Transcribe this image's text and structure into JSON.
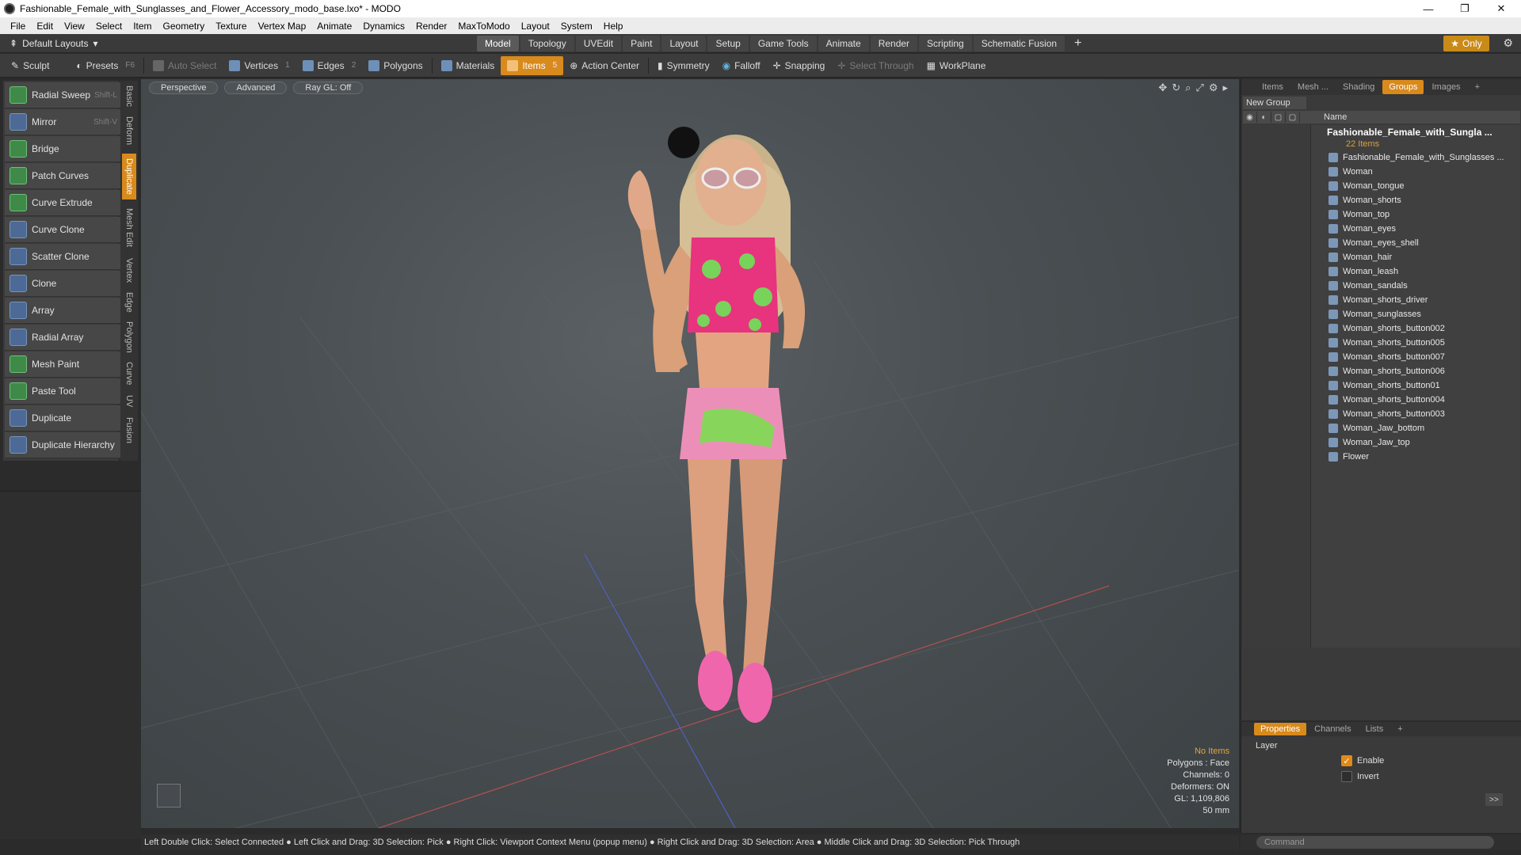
{
  "window": {
    "title": "Fashionable_Female_with_Sunglasses_and_Flower_Accessory_modo_base.lxo* - MODO",
    "controls": {
      "minimize": "—",
      "maximize": "❐",
      "close": "✕"
    }
  },
  "menu": [
    "File",
    "Edit",
    "View",
    "Select",
    "Item",
    "Geometry",
    "Texture",
    "Vertex Map",
    "Animate",
    "Dynamics",
    "Render",
    "MaxToModo",
    "Layout",
    "System",
    "Help"
  ],
  "layouts": {
    "preset": "Default Layouts",
    "tabs": [
      "Model",
      "Topology",
      "UVEdit",
      "Paint",
      "Layout",
      "Setup",
      "Game Tools",
      "Animate",
      "Render",
      "Scripting",
      "Schematic Fusion"
    ],
    "active_tab": "Model",
    "add": "+",
    "only": "Only"
  },
  "toolbar": {
    "sculpt": "Sculpt",
    "presets": "Presets",
    "presets_key": "F6",
    "auto_select": "Auto Select",
    "vertices": "Vertices",
    "vertices_count": "1",
    "edges": "Edges",
    "edges_count": "2",
    "polygons": "Polygons",
    "materials": "Materials",
    "items": "Items",
    "items_count": "5",
    "action_center": "Action Center",
    "symmetry": "Symmetry",
    "falloff": "Falloff",
    "snapping": "Snapping",
    "select_through": "Select Through",
    "workplane": "WorkPlane"
  },
  "tools": [
    {
      "label": "Radial Sweep",
      "shortcut": "Shift-L"
    },
    {
      "label": "Mirror",
      "shortcut": "Shift-V"
    },
    {
      "label": "Bridge",
      "shortcut": ""
    },
    {
      "label": "Patch Curves",
      "shortcut": ""
    },
    {
      "label": "Curve Extrude",
      "shortcut": ""
    },
    {
      "label": "Curve Clone",
      "shortcut": ""
    },
    {
      "label": "Scatter Clone",
      "shortcut": ""
    },
    {
      "label": "Clone",
      "shortcut": ""
    },
    {
      "label": "Array",
      "shortcut": ""
    },
    {
      "label": "Radial Array",
      "shortcut": ""
    },
    {
      "label": "Mesh Paint",
      "shortcut": ""
    },
    {
      "label": "Paste Tool",
      "shortcut": ""
    },
    {
      "label": "Duplicate",
      "shortcut": ""
    },
    {
      "label": "Duplicate Hierarchy",
      "shortcut": ""
    }
  ],
  "side_tabs": [
    "Basic",
    "Deform",
    "Duplicate",
    "Mesh Edit",
    "Vertex",
    "Edge",
    "Polygon",
    "Curve",
    "UV",
    "Fusion"
  ],
  "active_side_tab": "Duplicate",
  "viewport": {
    "view": "Perspective",
    "shading": "Advanced",
    "raygl": "Ray GL: Off",
    "info": {
      "selection": "No Items",
      "polygons": "Polygons : Face",
      "channels": "Channels: 0",
      "deformers": "Deformers: ON",
      "gl": "GL: 1,109,806",
      "focal": "50 mm"
    }
  },
  "status_bar": "Left Double Click: Select Connected ● Left Click and Drag: 3D Selection: Pick ● Right Click: Viewport Context Menu (popup menu) ● Right Click and Drag: 3D Selection: Area ● Middle Click and Drag: 3D Selection: Pick Through",
  "right_panel": {
    "tabs": [
      "Items",
      "Mesh ...",
      "Shading",
      "Groups",
      "Images",
      "+"
    ],
    "active_tab": "Groups",
    "new_group": "New Group",
    "column_name": "Name",
    "group_name": "Fashionable_Female_with_Sungla ...",
    "group_count": "22 Items",
    "items": [
      "Fashionable_Female_with_Sunglasses ...",
      "Woman",
      "Woman_tongue",
      "Woman_shorts",
      "Woman_top",
      "Woman_eyes",
      "Woman_eyes_shell",
      "Woman_hair",
      "Woman_leash",
      "Woman_sandals",
      "Woman_shorts_driver",
      "Woman_sunglasses",
      "Woman_shorts_button002",
      "Woman_shorts_button005",
      "Woman_shorts_button007",
      "Woman_shorts_button006",
      "Woman_shorts_button01",
      "Woman_shorts_button004",
      "Woman_shorts_button003",
      "Woman_Jaw_bottom",
      "Woman_Jaw_top",
      "Flower"
    ]
  },
  "properties": {
    "tabs": [
      "Properties",
      "Channels",
      "Lists",
      "+"
    ],
    "active_tab": "Properties",
    "section": "Layer",
    "enable": "Enable",
    "invert": "Invert",
    "more": ">>"
  },
  "command": {
    "placeholder": "Command"
  }
}
